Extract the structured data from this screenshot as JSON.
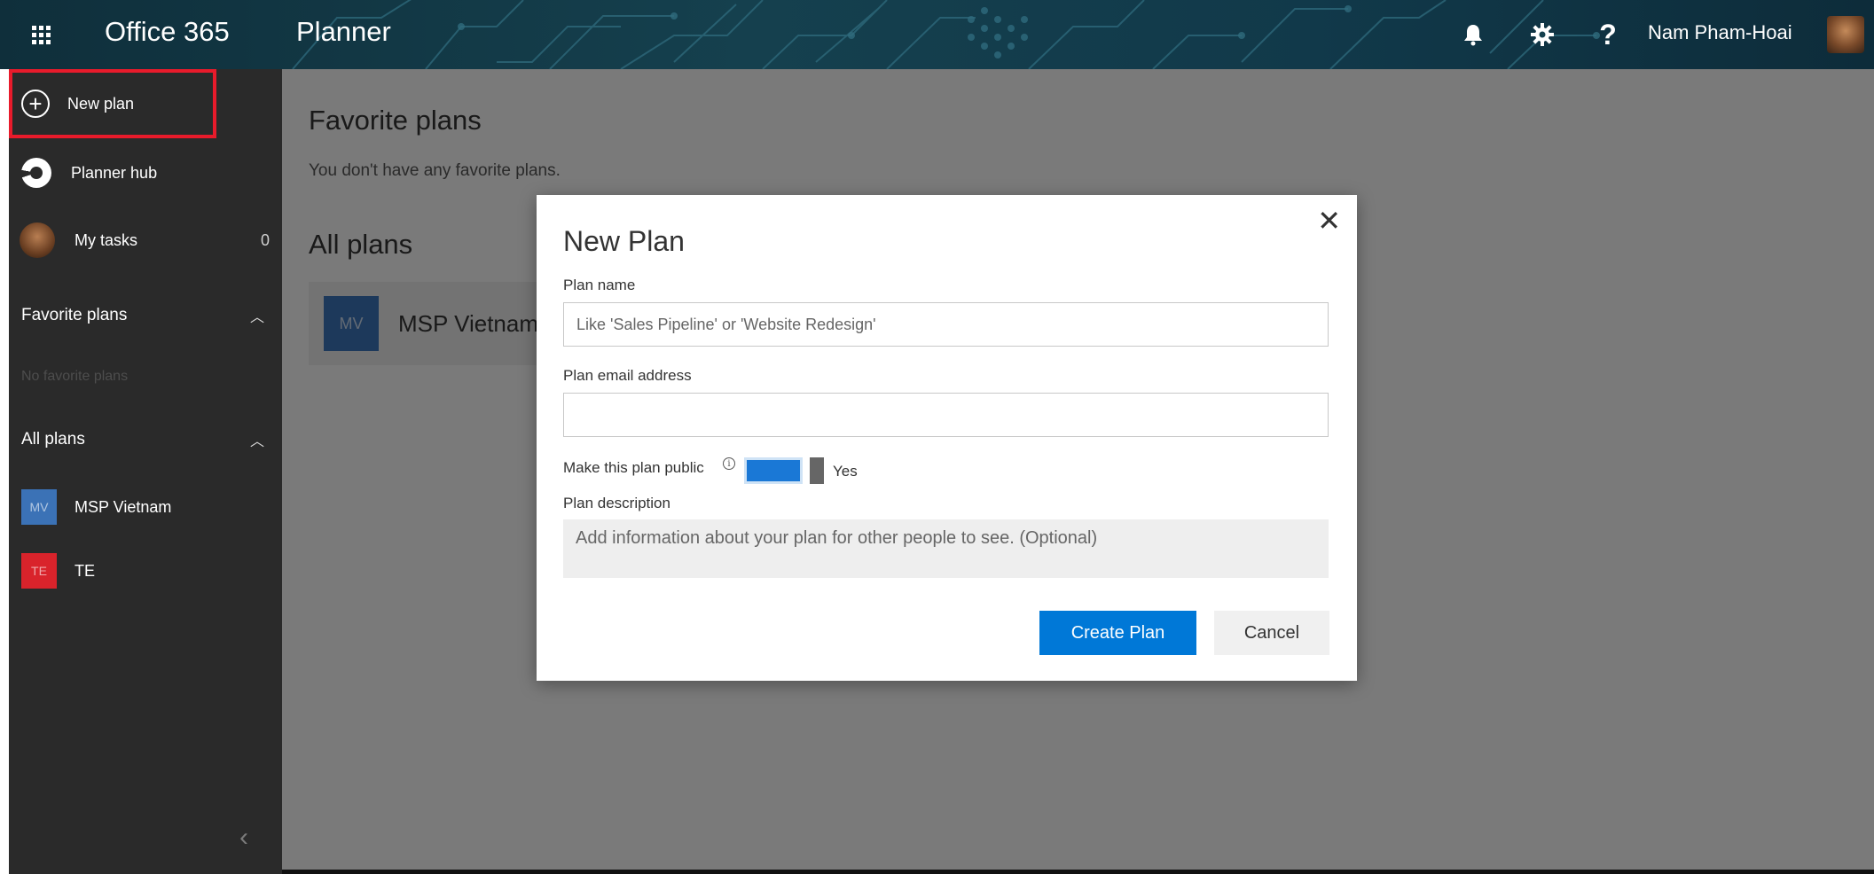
{
  "header": {
    "suite_name": "Office 365",
    "app_name": "Planner",
    "icons": [
      "app-launcher-icon",
      "bell-icon",
      "gear-icon",
      "help-icon"
    ],
    "help_glyph": "?",
    "user_name": "Nam Pham-Hoai"
  },
  "sidebar": {
    "new_plan_label": "New plan",
    "planner_hub_label": "Planner hub",
    "my_tasks_label": "My tasks",
    "my_tasks_count": "0",
    "favorite_plans_heading": "Favorite plans",
    "no_favorite_plans": "No favorite plans",
    "all_plans_heading": "All plans",
    "plans": [
      {
        "initials": "MV",
        "name": "MSP Vietnam",
        "color": "#3b72b6"
      },
      {
        "initials": "TE",
        "name": "TE",
        "color": "#d9232b"
      }
    ]
  },
  "main": {
    "favorite_plans_title": "Favorite plans",
    "no_favorites_message": "You don't have any favorite plans.",
    "all_plans_title": "All plans",
    "plan_card": {
      "initials": "MV",
      "name": "MSP Vietnam"
    }
  },
  "dialog": {
    "title": "New Plan",
    "plan_name_label": "Plan name",
    "plan_name_placeholder": "Like 'Sales Pipeline' or 'Website Redesign'",
    "plan_name_value": "",
    "email_label": "Plan email address",
    "email_value": "",
    "public_label": "Make this plan public",
    "public_value": "Yes",
    "description_label": "Plan description",
    "description_placeholder": "Add information about your plan for other people to see. (Optional)",
    "create_button": "Create Plan",
    "cancel_button": "Cancel"
  },
  "colors": {
    "accent": "#0078d7",
    "sidebar_bg": "#2a2a2a",
    "highlight_border": "#e81b2b"
  }
}
